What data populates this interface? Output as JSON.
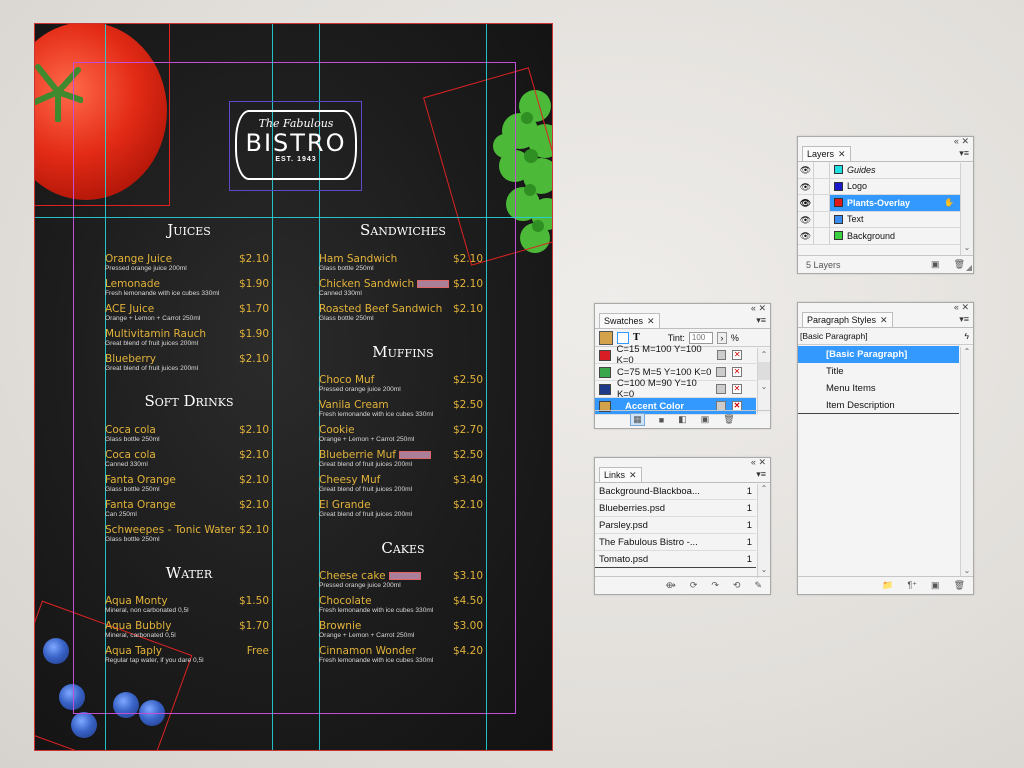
{
  "menu": {
    "logo": {
      "script": "The Fabulous",
      "main": "BISTRO",
      "est": "EST. 1943"
    },
    "sections": {
      "juices": "Juices",
      "soft_drinks": "Soft Drinks",
      "water": "Water",
      "sandwiches": "Sandwiches",
      "muffins": "Muffins",
      "cakes": "Cakes"
    },
    "juices": [
      {
        "name": "Orange Juice",
        "desc": "Pressed orange juice 200ml",
        "price": "$2.10"
      },
      {
        "name": "Lemonade",
        "desc": "Fresh lemonande with ice cubes 330ml",
        "price": "$1.90"
      },
      {
        "name": "ACE Juice",
        "desc": "Orange + Lemon + Carrot 250ml",
        "price": "$1.70"
      },
      {
        "name": "Multivitamin Rauch",
        "desc": "Great blend of fruit juices 200ml",
        "price": "$1.90"
      },
      {
        "name": "Blueberry",
        "desc": "Great blend of fruit juices 200ml",
        "price": "$2.10"
      }
    ],
    "soft_drinks": [
      {
        "name": "Coca cola",
        "desc": "Glass bottle 250ml",
        "price": "$2.10"
      },
      {
        "name": "Coca cola",
        "desc": "Canned 330ml",
        "price": "$2.10"
      },
      {
        "name": "Fanta Orange",
        "desc": "Glass bottle 250ml",
        "price": "$2.10"
      },
      {
        "name": "Fanta Orange",
        "desc": "Can 250ml",
        "price": "$2.10"
      },
      {
        "name": "Schweepes - Tonic Water",
        "desc": "Glass bottle 250ml",
        "price": "$2.10"
      }
    ],
    "water": [
      {
        "name": "Aqua Monty",
        "desc": "Mineral, non carbonated 0,5l",
        "price": "$1.50"
      },
      {
        "name": "Aqua Bubbly",
        "desc": "Mineral, carbonated 0,5l",
        "price": "$1.70"
      },
      {
        "name": "Aqua Taply",
        "desc": "Regular tap water, if you dare 0,5l",
        "price": "Free"
      }
    ],
    "sandwiches": [
      {
        "name": "Ham Sandwich",
        "desc": "Glass bottle 250ml",
        "price": "$2.10"
      },
      {
        "name": "Chicken Sandwich",
        "desc": "Canned 330ml",
        "price": "$2.10"
      },
      {
        "name": "Roasted Beef Sandwich",
        "desc": "Glass bottle 250ml",
        "price": "$2.10"
      }
    ],
    "muffins": [
      {
        "name": "Choco Muf",
        "desc": "Pressed orange juice 200ml",
        "price": "$2.50"
      },
      {
        "name": "Vanila Cream",
        "desc": "Fresh lemonande with ice cubes 330ml",
        "price": "$2.50"
      },
      {
        "name": "Cookie",
        "desc": "Orange + Lemon + Carrot 250ml",
        "price": "$2.70"
      },
      {
        "name": "Blueberrie Muf",
        "desc": "Great blend of fruit juices 200ml",
        "price": "$2.50"
      },
      {
        "name": "Cheesy Muf",
        "desc": "Great blend of fruit juices 200ml",
        "price": "$3.40"
      },
      {
        "name": "El Grande",
        "desc": "Great blend of fruit juices 200ml",
        "price": "$2.10"
      }
    ],
    "cakes": [
      {
        "name": "Cheese cake",
        "desc": "Pressed orange juice 200ml",
        "price": "$3.10"
      },
      {
        "name": "Chocolate",
        "desc": "Fresh lemonande with ice cubes 330ml",
        "price": "$4.50"
      },
      {
        "name": "Brownie",
        "desc": "Orange + Lemon + Carrot 250ml",
        "price": "$3.00"
      },
      {
        "name": "Cinnamon Wonder",
        "desc": "Fresh lemonande with ice cubes 330ml",
        "price": "$4.20"
      }
    ]
  },
  "layers_panel": {
    "tab": "Layers",
    "layers": [
      {
        "name": "Guides",
        "color": "#1ee0e0"
      },
      {
        "name": "Logo",
        "color": "#1a1acc"
      },
      {
        "name": "Plants-Overlay",
        "color": "#e01818"
      },
      {
        "name": "Text",
        "color": "#3a8cf0"
      },
      {
        "name": "Background",
        "color": "#3ad040"
      }
    ],
    "footer": "5 Layers"
  },
  "swatches_panel": {
    "tab": "Swatches",
    "tint_label": "Tint:",
    "tint_value": "100",
    "tint_unit": "%",
    "swatches": [
      {
        "name": "C=15 M=100 Y=100 K=0",
        "color": "#d81e24"
      },
      {
        "name": "C=75 M=5 Y=100 K=0",
        "color": "#3aa84a"
      },
      {
        "name": "C=100 M=90 Y=10 K=0",
        "color": "#1e3a8a"
      },
      {
        "name": "Accent Color",
        "color": "#d3a24a"
      }
    ]
  },
  "links_panel": {
    "tab": "Links",
    "links": [
      {
        "name": "Background-Blackboa...",
        "count": "1"
      },
      {
        "name": "Blueberries.psd",
        "count": "1"
      },
      {
        "name": "Parsley.psd",
        "count": "1"
      },
      {
        "name": "The Fabulous Bistro -...",
        "count": "1"
      },
      {
        "name": "Tomato.psd",
        "count": "1"
      }
    ]
  },
  "paragraph_styles_panel": {
    "tab": "Paragraph Styles",
    "current": "[Basic Paragraph]",
    "styles": [
      "[Basic Paragraph]",
      "Title",
      "Menu Items",
      "Item Description"
    ]
  }
}
